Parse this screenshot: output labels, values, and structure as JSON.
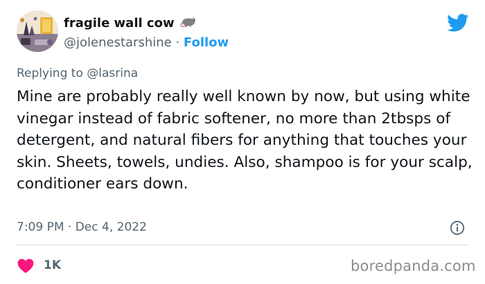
{
  "author": {
    "display_name": "fragile wall cow",
    "handle": "@jolenestarshine",
    "separator": "·",
    "follow_label": "Follow"
  },
  "reply": {
    "prefix": "Replying to",
    "mention": "@lasrina"
  },
  "tweet": {
    "text": "Mine are probably really well known by now, but using white vinegar instead of fabric softener, no more than 2tbsps of detergent, and natural fibers for anything that touches your skin. Sheets, towels, undies. Also, shampoo is for your scalp, conditioner ears down."
  },
  "meta": {
    "timestamp": "7:09 PM · Dec 4, 2022"
  },
  "engagement": {
    "likes": "1K"
  },
  "watermark": "boredpanda.com",
  "icons": {
    "brand": "twitter-bird-icon",
    "info": "info-icon",
    "like": "heart-icon",
    "emoji": "rat-icon"
  },
  "colors": {
    "accent": "#1d9bf0",
    "like": "#f91880",
    "muted": "#536471",
    "text": "#0f1419"
  }
}
